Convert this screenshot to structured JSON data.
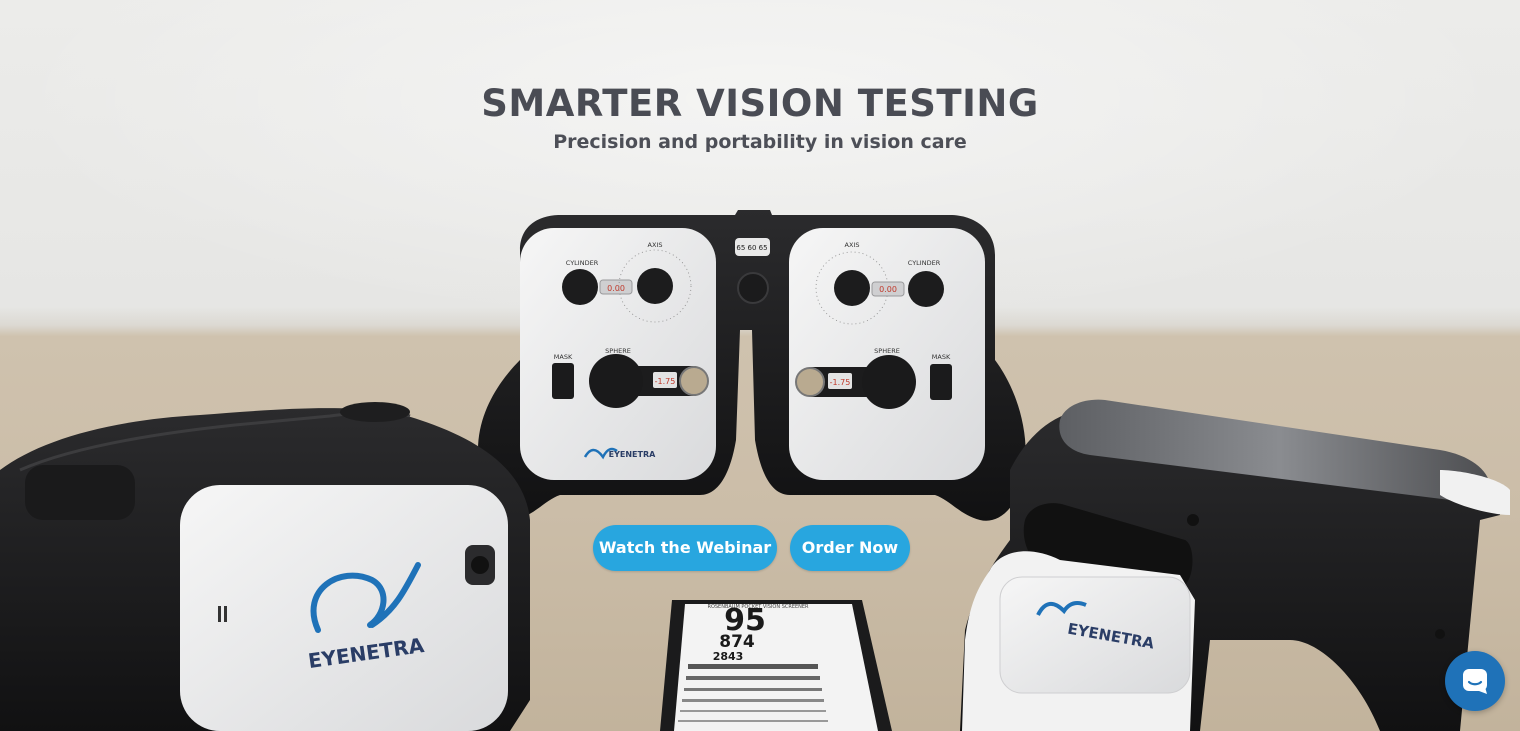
{
  "hero": {
    "headline": "SMARTER VISION TESTING",
    "subheadline": "Precision and portability in vision care"
  },
  "cta": {
    "webinar_label": "Watch the Webinar",
    "order_label": "Order Now",
    "color": "#28a6df"
  },
  "product": {
    "logo_text": "EYENETRA",
    "chart_title": "ROSENBAUM POCKET VISION SCREENER",
    "chart_line1": "95",
    "chart_line2": "874",
    "chart_line3": "2843",
    "left_device": {
      "cylinder_label": "CYLINDER",
      "axis_label": "AXIS",
      "sphere_label": "SPHERE",
      "mask_label": "MASK",
      "cylinder_value": "0.00",
      "sphere_value": "-1.75"
    },
    "right_device": {
      "cylinder_label": "CYLINDER",
      "axis_label": "AXIS",
      "sphere_label": "SPHERE",
      "mask_label": "MASK",
      "cylinder_value": "0.00",
      "sphere_value": "-1.75"
    },
    "pd_scale": "65 60 65"
  },
  "chat": {
    "icon": "chat-icon",
    "color": "#1f72b8"
  }
}
